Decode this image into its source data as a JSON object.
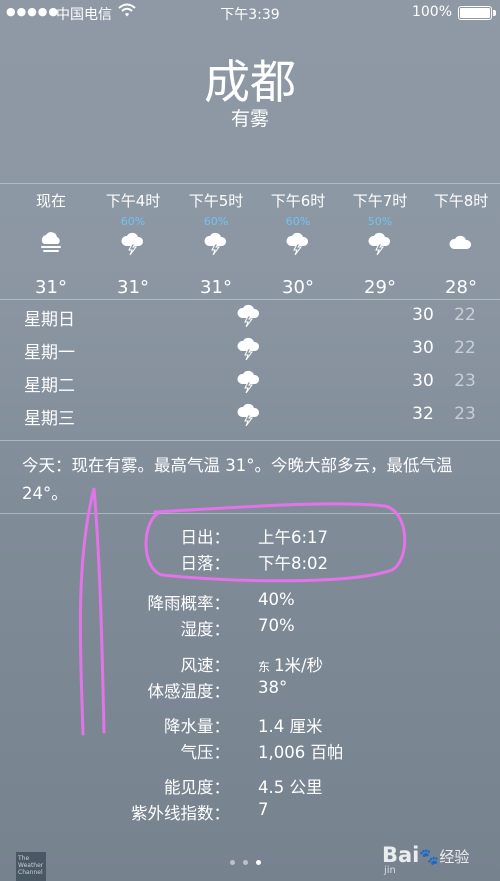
{
  "status_bar": {
    "signal": "●●●●●",
    "carrier": "中国电信",
    "time": "下午3:39",
    "battery": "100%",
    "battery_level": 1.0
  },
  "location": {
    "city": "成都",
    "condition": "有雾"
  },
  "hourly": [
    {
      "time": "现在",
      "pop": "",
      "icon": "fog-icon",
      "temp": "31°"
    },
    {
      "time": "下午4时",
      "pop": "60%",
      "icon": "thunderstorm-icon",
      "temp": "31°"
    },
    {
      "time": "下午5时",
      "pop": "60%",
      "icon": "thunderstorm-icon",
      "temp": "31°"
    },
    {
      "time": "下午6时",
      "pop": "60%",
      "icon": "thunderstorm-icon",
      "temp": "30°"
    },
    {
      "time": "下午7时",
      "pop": "50%",
      "icon": "thunderstorm-icon",
      "temp": "29°"
    },
    {
      "time": "下午8时",
      "pop": "",
      "icon": "cloud-icon",
      "temp": "28°"
    }
  ],
  "daily": [
    {
      "day": "星期日",
      "icon": "thunderstorm-icon",
      "high": "30",
      "low": "22"
    },
    {
      "day": "星期一",
      "icon": "thunderstorm-icon",
      "high": "30",
      "low": "22"
    },
    {
      "day": "星期二",
      "icon": "thunderstorm-icon",
      "high": "30",
      "low": "23"
    },
    {
      "day": "星期三",
      "icon": "thunderstorm-icon",
      "high": "32",
      "low": "23"
    }
  ],
  "summary": "今天：现在有雾。最高气温 31°。今晚大部多云，最低气温 24°。",
  "details": [
    {
      "label": "日出：",
      "value": "上午6:17"
    },
    {
      "label": "日落：",
      "value": "下午8:02"
    },
    {
      "label": "降雨概率：",
      "value": "40%"
    },
    {
      "label": "湿度：",
      "value": "70%"
    },
    {
      "label": "风速：",
      "dir": "东",
      "value": "1米/秒"
    },
    {
      "label": "体感温度：",
      "value": "38°"
    },
    {
      "label": "降水量：",
      "value": "1.4 厘米"
    },
    {
      "label": "气压：",
      "value": "1,006 百帕"
    },
    {
      "label": "能见度：",
      "value": "4.5 公里"
    },
    {
      "label": "紫外线指数：",
      "value": "7"
    }
  ],
  "footer": {
    "logo_text": "The Weather Channel",
    "page_count": 3,
    "active_page": 2,
    "watermark": "Bai",
    "watermark_paw": "🐾",
    "watermark_tail": "经验",
    "watermark_sub": "jin"
  },
  "colors": {
    "precip": "#6ec3f5",
    "annotation": "#e373e8"
  }
}
